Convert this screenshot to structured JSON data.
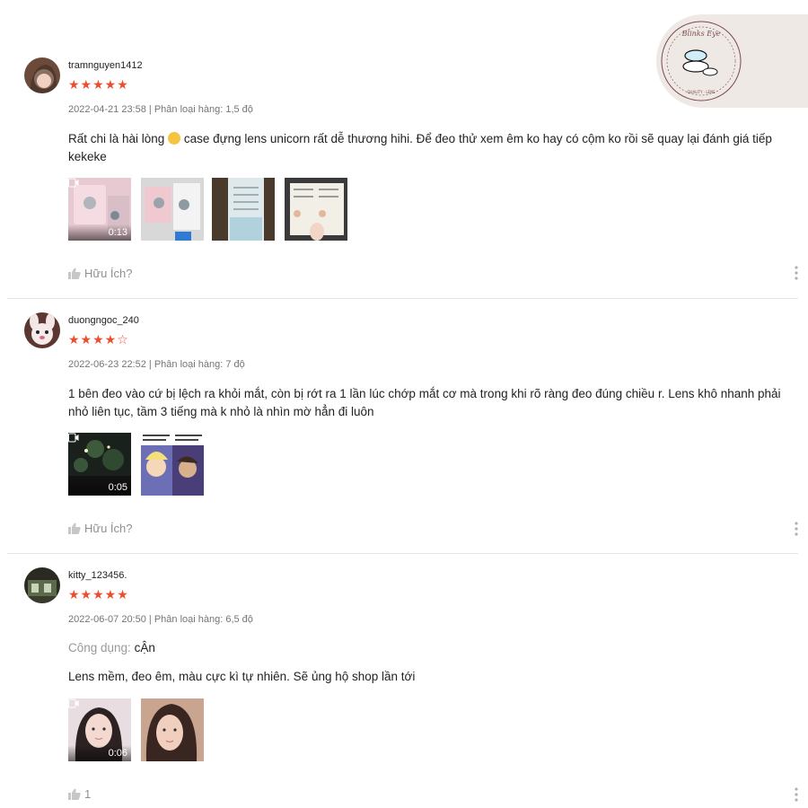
{
  "watermark": {
    "brand": "Blinks Eye",
    "tagline": "QUALITY · LENS"
  },
  "reviews": [
    {
      "username": "tramnguyen1412",
      "rating": 5,
      "stars": "★★★★★",
      "meta": "2022-04-21 23:58 | Phân loại hàng: 1,5 độ",
      "content_before_emoji": "Rất chi là hài lòng ",
      "emoji": "grinning-face-emoji",
      "content_after_emoji": " case đựng lens unicorn rất dễ thương hihi. Để đeo thử xem êm ko hay có cộm ko rồi sẽ quay lại đánh giá tiếp kekeke",
      "video_duration": "0:13",
      "helpful_label": "Hữu Ích?",
      "media": [
        "video",
        "photo",
        "photo",
        "photo"
      ]
    },
    {
      "username": "duongngoc_240",
      "rating": 4,
      "stars": "★★★★☆",
      "meta": "2022-06-23 22:52 | Phân loại hàng: 7 độ",
      "content": "1 bên đeo vào cứ bị lệch ra khỏi mắt, còn bị rớt ra 1 lần lúc chớp mắt cơ mà trong khi rõ ràng đeo đúng chiều r. Lens khô nhanh phải nhỏ liên tục, tầm 3 tiếng mà k nhỏ là nhìn mờ hẳn đi luôn",
      "video_duration": "0:05",
      "helpful_label": "Hữu Ích?",
      "media": [
        "video",
        "photo"
      ]
    },
    {
      "username": "kitty_123456.",
      "rating": 5,
      "stars": "★★★★★",
      "meta": "2022-06-07 20:50 | Phân loại hàng: 6,5 độ",
      "attr_key": "Công dụng:",
      "attr_value": "cẬn",
      "content": "Lens mềm, đeo êm, màu cực kì tự nhiên. Sẽ ủng hộ shop lần tới",
      "video_duration": "0:06",
      "helpful_count": "1",
      "media": [
        "video",
        "photo"
      ]
    }
  ],
  "colors": {
    "star": "#ee4d2d",
    "meta": "#757575",
    "divider": "#e5e5e5"
  },
  "icons": {
    "like": "thumbs-up-icon",
    "more": "more-vertical-icon",
    "video": "video-camera-icon"
  }
}
